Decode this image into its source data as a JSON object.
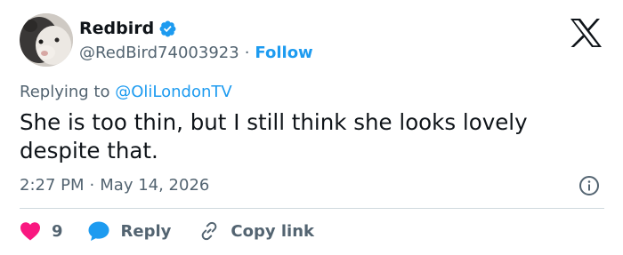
{
  "author": {
    "display_name": "Redbird",
    "handle": "@RedBird74003923",
    "separator": "·",
    "follow_label": "Follow"
  },
  "reply_context": {
    "prefix": "Replying to",
    "mention": "@OliLondonTV"
  },
  "tweet": {
    "text": "She is too thin, but I still think she looks lovely despite that."
  },
  "meta": {
    "time": "2:27 PM",
    "separator": "·",
    "date": "May 14, 2026"
  },
  "actions": {
    "like_count": "9",
    "reply_label": "Reply",
    "copy_link_label": "Copy link"
  },
  "colors": {
    "accent": "#1d9bf0",
    "like": "#f91880",
    "secondary_text": "#536471",
    "primary_text": "#0f1419"
  },
  "icons": [
    "verified-badge-icon",
    "x-logo-icon",
    "info-icon",
    "heart-icon",
    "reply-bubble-icon",
    "link-icon"
  ]
}
